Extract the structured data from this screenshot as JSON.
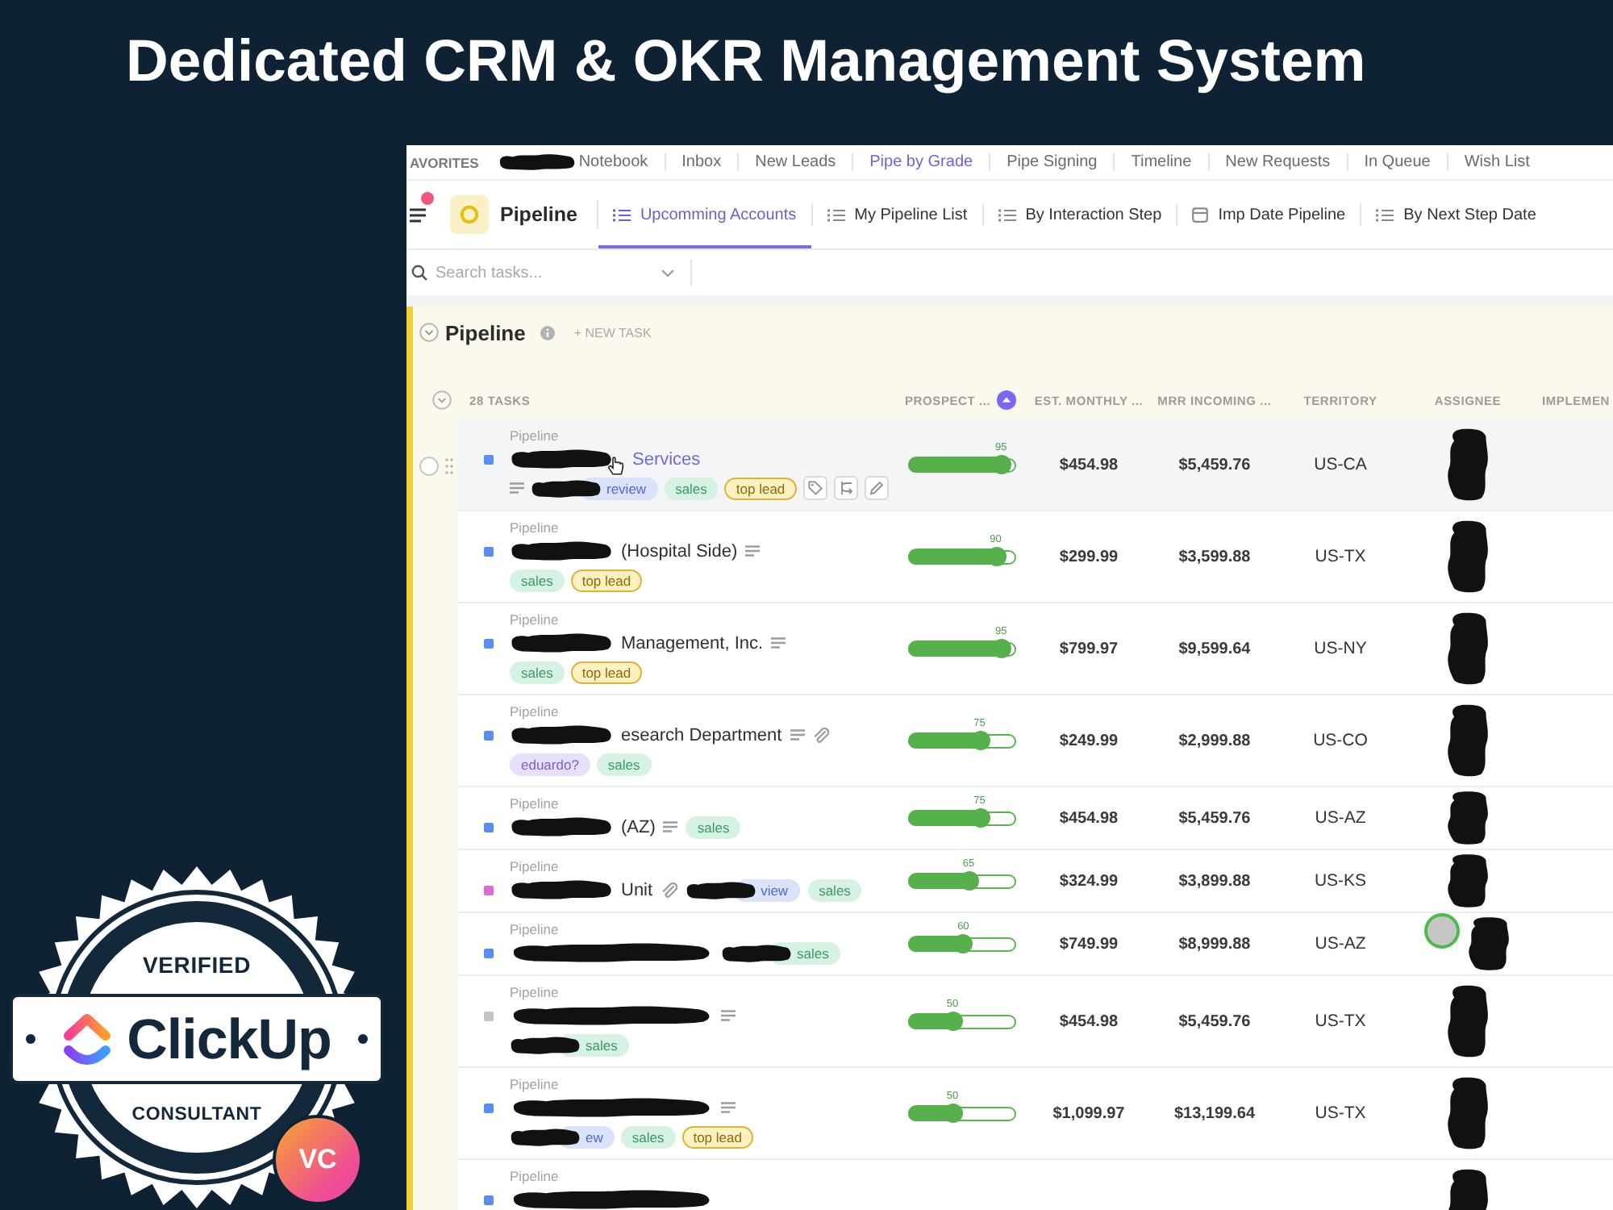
{
  "heading": "Dedicated CRM & OKR Management System",
  "badge": {
    "top": "VERIFIED",
    "brand": "ClickUp",
    "bottom": "CONSULTANT",
    "corner": "VC"
  },
  "favorites": {
    "label": "AVORITES",
    "items": [
      {
        "label": "Notebook",
        "selected": false,
        "redacted": true
      },
      {
        "label": "Inbox",
        "selected": false,
        "redacted": false
      },
      {
        "label": "New Leads",
        "selected": false,
        "redacted": false
      },
      {
        "label": "Pipe by Grade",
        "selected": true,
        "redacted": false
      },
      {
        "label": "Pipe Signing",
        "selected": false,
        "redacted": false
      },
      {
        "label": "Timeline",
        "selected": false,
        "redacted": false
      },
      {
        "label": "New Requests",
        "selected": false,
        "redacted": false
      },
      {
        "label": "In Queue",
        "selected": false,
        "redacted": false
      },
      {
        "label": "Wish List",
        "selected": false,
        "redacted": false
      }
    ]
  },
  "header": {
    "space": "Pipeline",
    "views": [
      {
        "label": "Upcomming Accounts",
        "kind": "list",
        "selected": true
      },
      {
        "label": "My Pipeline List",
        "kind": "list",
        "selected": false
      },
      {
        "label": "By Interaction Step",
        "kind": "list",
        "selected": false
      },
      {
        "label": "Imp Date Pipeline",
        "kind": "calendar",
        "selected": false
      },
      {
        "label": "By Next Step Date",
        "kind": "list",
        "selected": false
      }
    ]
  },
  "search": {
    "placeholder": "Search tasks..."
  },
  "list": {
    "title": "Pipeline",
    "new_task": "+ NEW TASK",
    "count": "28 TASKS",
    "columns": [
      {
        "label": "PROSPECT ...",
        "sorted": true
      },
      {
        "label": "EST. MONTHLY ...",
        "sorted": false
      },
      {
        "label": "MRR INCOMING ...",
        "sorted": false
      },
      {
        "label": "TERRITORY",
        "sorted": false
      },
      {
        "label": "ASSIGNEE",
        "sorted": false
      },
      {
        "label": "IMPLEMEN",
        "sorted": false
      }
    ],
    "rows": [
      {
        "list": "Pipeline",
        "color": "#5b8def",
        "hovered": true,
        "redacted": true,
        "name": "Services",
        "description": true,
        "attachment": false,
        "kind": "two-line",
        "tags": [
          {
            "label": "review",
            "kind": "review",
            "covered": true
          },
          {
            "label": "sales",
            "kind": "sales",
            "covered": false
          },
          {
            "label": "top lead",
            "kind": "lead",
            "covered": false
          }
        ],
        "prospect": {
          "reading": "95",
          "level": 0.95
        },
        "est_monthly": "$454.98",
        "mrr_incoming": "$5,459.76",
        "territory": "US-CA",
        "assignee_redacted": true,
        "avatar": false
      },
      {
        "list": "Pipeline",
        "color": "#5b8def",
        "hovered": false,
        "redacted": true,
        "name": "(Hospital Side)",
        "description": true,
        "attachment": false,
        "kind": "two-line",
        "tags": [
          {
            "label": "sales",
            "kind": "sales",
            "covered": false
          },
          {
            "label": "top lead",
            "kind": "lead",
            "covered": false
          }
        ],
        "prospect": {
          "reading": "90",
          "level": 0.9
        },
        "est_monthly": "$299.99",
        "mrr_incoming": "$3,599.88",
        "territory": "US-TX",
        "assignee_redacted": true,
        "avatar": false
      },
      {
        "list": "Pipeline",
        "color": "#5b8def",
        "hovered": false,
        "redacted": true,
        "name": "Management, Inc.",
        "description": true,
        "attachment": false,
        "kind": "two-line",
        "tags": [
          {
            "label": "sales",
            "kind": "sales",
            "covered": false
          },
          {
            "label": "top lead",
            "kind": "lead",
            "covered": false
          }
        ],
        "prospect": {
          "reading": "95",
          "level": 0.95
        },
        "est_monthly": "$799.97",
        "mrr_incoming": "$9,599.64",
        "territory": "US-NY",
        "assignee_redacted": true,
        "avatar": false
      },
      {
        "list": "Pipeline",
        "color": "#5b8def",
        "hovered": false,
        "redacted": true,
        "name": "esearch Department",
        "description": true,
        "attachment": true,
        "kind": "two-line",
        "tags": [
          {
            "label": "eduardo?",
            "kind": "person",
            "covered": false
          },
          {
            "label": "sales",
            "kind": "sales",
            "covered": false
          }
        ],
        "prospect": {
          "reading": "75",
          "level": 0.75
        },
        "est_monthly": "$249.99",
        "mrr_incoming": "$2,999.88",
        "territory": "US-CO",
        "assignee_redacted": true,
        "avatar": false
      },
      {
        "list": "Pipeline",
        "color": "#5b8def",
        "hovered": false,
        "redacted": true,
        "name": "(AZ)",
        "description": true,
        "attachment": false,
        "kind": "one-line",
        "tags": [
          {
            "label": "sales",
            "kind": "sales",
            "covered": false
          }
        ],
        "prospect": {
          "reading": "75",
          "level": 0.75
        },
        "est_monthly": "$454.98",
        "mrr_incoming": "$5,459.76",
        "territory": "US-AZ",
        "assignee_redacted": true,
        "avatar": false
      },
      {
        "list": "Pipeline",
        "color": "#d96ad6",
        "hovered": false,
        "redacted": true,
        "name": "Unit",
        "description": false,
        "attachment": true,
        "kind": "one-line",
        "tags": [
          {
            "label": "view",
            "kind": "review",
            "covered": true
          },
          {
            "label": "sales",
            "kind": "sales",
            "covered": false
          }
        ],
        "prospect": {
          "reading": "65",
          "level": 0.65
        },
        "est_monthly": "$324.99",
        "mrr_incoming": "$3,899.88",
        "territory": "US-KS",
        "assignee_redacted": true,
        "avatar": false
      },
      {
        "list": "Pipeline",
        "color": "#5b8def",
        "hovered": false,
        "redacted": true,
        "description": false,
        "attachment": false,
        "kind": "one-line",
        "tags": [
          {
            "label": "sales",
            "kind": "sales",
            "covered": true
          }
        ],
        "prospect": {
          "reading": "60",
          "level": 0.6
        },
        "est_monthly": "$749.99",
        "mrr_incoming": "$8,999.88",
        "territory": "US-AZ",
        "assignee_redacted": true,
        "avatar": true
      },
      {
        "list": "Pipeline",
        "color": "#c4c4c4",
        "hovered": false,
        "redacted": true,
        "description": true,
        "attachment": false,
        "kind": "two-line",
        "tags": [
          {
            "label": "sales",
            "kind": "sales",
            "covered": true
          }
        ],
        "prospect": {
          "reading": "50",
          "level": 0.5
        },
        "est_monthly": "$454.98",
        "mrr_incoming": "$5,459.76",
        "territory": "US-TX",
        "assignee_redacted": true,
        "avatar": false
      },
      {
        "list": "Pipeline",
        "color": "#5b8def",
        "hovered": false,
        "redacted": true,
        "description": true,
        "attachment": false,
        "kind": "two-line",
        "tags": [
          {
            "label": "ew",
            "kind": "review",
            "covered": true
          },
          {
            "label": "sales",
            "kind": "sales",
            "covered": false
          },
          {
            "label": "top lead",
            "kind": "lead",
            "covered": false
          }
        ],
        "prospect": {
          "reading": "50",
          "level": 0.5
        },
        "est_monthly": "$1,099.97",
        "mrr_incoming": "$13,199.64",
        "territory": "US-TX",
        "assignee_redacted": true,
        "avatar": false
      },
      {
        "list": "Pipeline",
        "color": "#5b8def",
        "hovered": false,
        "redacted": true,
        "description": false,
        "attachment": false,
        "kind": "two-line",
        "assignee_redacted": true,
        "avatar": false
      }
    ]
  }
}
